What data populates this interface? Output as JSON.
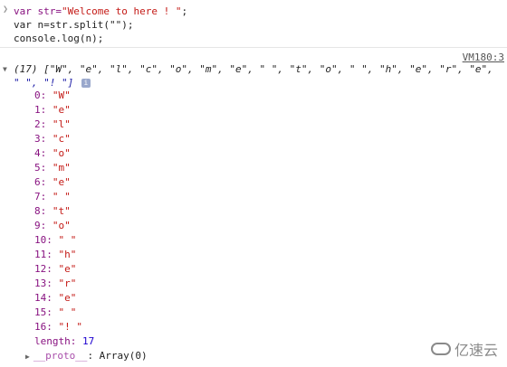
{
  "input": {
    "line1_prefix": "var str=",
    "line1_string": "\"Welcome to here ! \"",
    "line1_suffix": ";",
    "line2": "var n=str.split(\"\");",
    "line3": "console.log(n);"
  },
  "output": {
    "source_link": "VM180:3",
    "summary_line1": "(17) [\"W\", \"e\", \"l\", \"c\", \"o\", \"m\", \"e\", \" \", \"t\", \"o\", \" \", \"h\", \"e\", \"r\", \"e\",",
    "summary_line2": "\" \", \"! \"]",
    "info_icon": "i",
    "items": [
      {
        "index": "0:",
        "value": "\"W\""
      },
      {
        "index": "1:",
        "value": "\"e\""
      },
      {
        "index": "2:",
        "value": "\"l\""
      },
      {
        "index": "3:",
        "value": "\"c\""
      },
      {
        "index": "4:",
        "value": "\"o\""
      },
      {
        "index": "5:",
        "value": "\"m\""
      },
      {
        "index": "6:",
        "value": "\"e\""
      },
      {
        "index": "7:",
        "value": "\" \""
      },
      {
        "index": "8:",
        "value": "\"t\""
      },
      {
        "index": "9:",
        "value": "\"o\""
      },
      {
        "index": "10:",
        "value": "\" \""
      },
      {
        "index": "11:",
        "value": "\"h\""
      },
      {
        "index": "12:",
        "value": "\"e\""
      },
      {
        "index": "13:",
        "value": "\"r\""
      },
      {
        "index": "14:",
        "value": "\"e\""
      },
      {
        "index": "15:",
        "value": "\" \""
      },
      {
        "index": "16:",
        "value": "\"! \""
      }
    ],
    "length_key": "length:",
    "length_value": "17",
    "proto_key": "__proto__",
    "proto_value": ": Array(0)"
  },
  "watermark": {
    "text": "亿速云",
    "icon": "cloud-logo-icon"
  }
}
